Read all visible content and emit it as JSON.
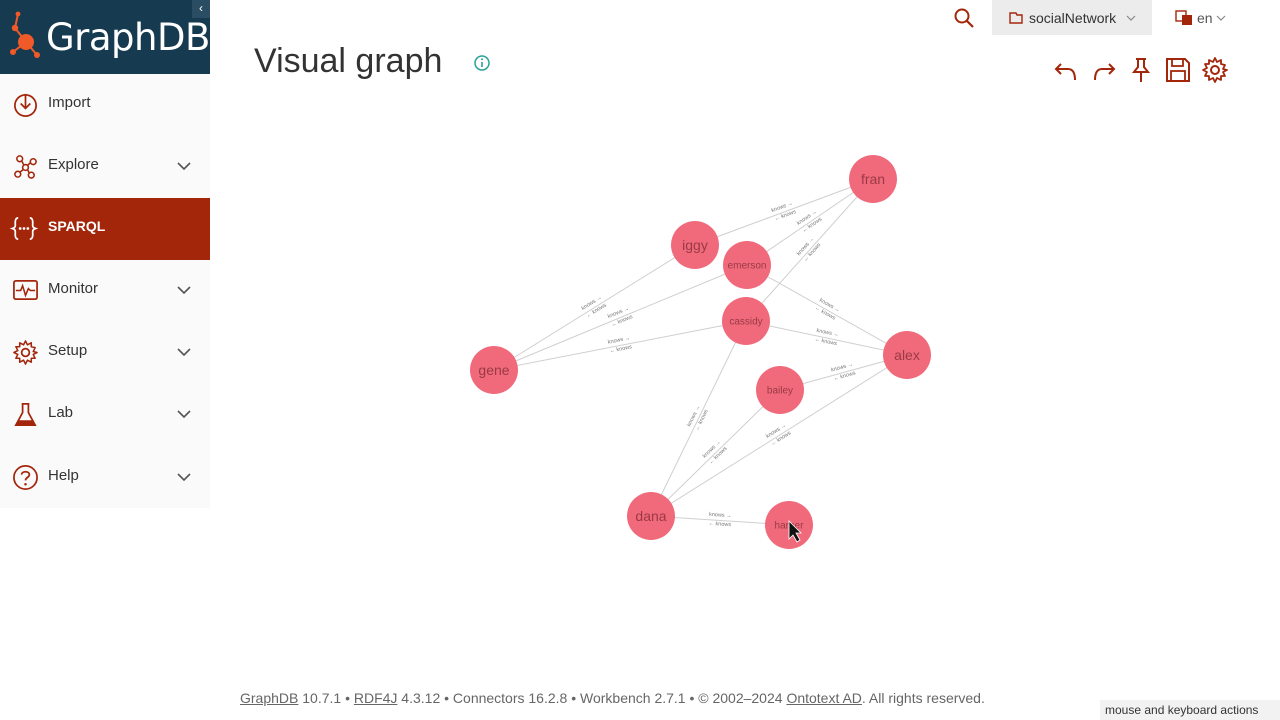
{
  "brand": {
    "name": "GraphDB",
    "collapse_glyph": "‹"
  },
  "sidebar": {
    "items": [
      {
        "label": "Import",
        "icon": "import-icon"
      },
      {
        "label": "Explore",
        "icon": "explore-icon"
      },
      {
        "label": "SPARQL",
        "icon": "sparql-icon"
      },
      {
        "label": "Monitor",
        "icon": "monitor-icon"
      },
      {
        "label": "Setup",
        "icon": "setup-icon"
      },
      {
        "label": "Lab",
        "icon": "lab-icon"
      },
      {
        "label": "Help",
        "icon": "help-icon"
      }
    ]
  },
  "topbar": {
    "repository": "socialNetwork",
    "language": "en"
  },
  "page": {
    "title": "Visual graph"
  },
  "graph": {
    "nodes": [
      {
        "id": "fran",
        "label": "fran"
      },
      {
        "id": "iggy",
        "label": "iggy"
      },
      {
        "id": "emerson",
        "label": "emerson"
      },
      {
        "id": "cassidy",
        "label": "cassidy"
      },
      {
        "id": "gene",
        "label": "gene"
      },
      {
        "id": "alex",
        "label": "alex"
      },
      {
        "id": "bailey",
        "label": "bailey"
      },
      {
        "id": "dana",
        "label": "dana"
      },
      {
        "id": "harper",
        "label": "harper"
      }
    ],
    "edge_label": "knows",
    "edges": [
      [
        "iggy",
        "fran"
      ],
      [
        "emerson",
        "fran"
      ],
      [
        "cassidy",
        "fran"
      ],
      [
        "gene",
        "iggy"
      ],
      [
        "gene",
        "emerson"
      ],
      [
        "gene",
        "cassidy"
      ],
      [
        "emerson",
        "alex"
      ],
      [
        "cassidy",
        "alex"
      ],
      [
        "bailey",
        "alex"
      ],
      [
        "dana",
        "cassidy"
      ],
      [
        "dana",
        "bailey"
      ],
      [
        "dana",
        "alex"
      ],
      [
        "dana",
        "harper"
      ]
    ]
  },
  "footer": {
    "graphdb": "GraphDB",
    "graphdb_version": " 10.7.1 • ",
    "rdf4j": "RDF4J",
    "rdf4j_rest": " 4.3.12 • Connectors 16.2.8 • Workbench 2.7.1 • © 2002–2024 ",
    "ontotext": "Ontotext AD",
    "rights": ". All rights reserved."
  },
  "tooltip": "mouse and keyboard actions",
  "colors": {
    "accent": "#a3260b",
    "brand_bg": "#163a50",
    "node": "#f06a7c",
    "logo_orange": "#f05a28"
  }
}
